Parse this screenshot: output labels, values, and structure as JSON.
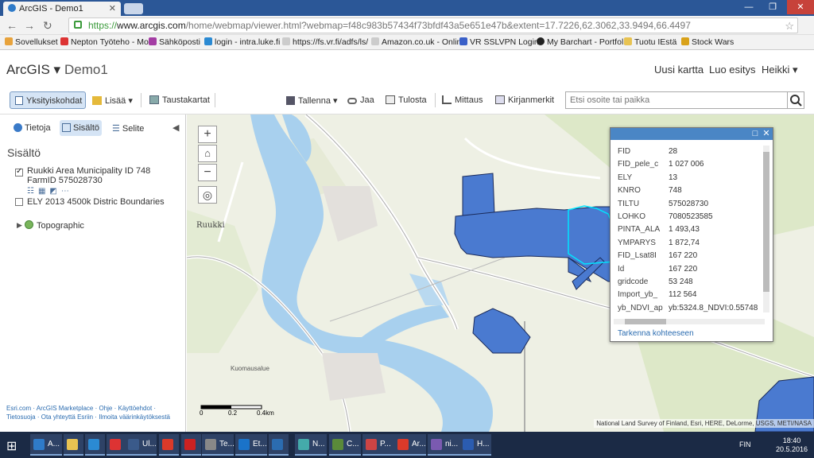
{
  "browser": {
    "tab_title": "ArcGIS - Demo1",
    "url_scheme": "https://",
    "url_host": "www.arcgis.com",
    "url_rest": "/home/webmap/viewer.html?webmap=f48c983b57434f73bfdf43a5e651e47b&extent=17.7226,62.3062,33.9494,66.4497",
    "bookmarks": [
      "Sovellukset",
      "Nepton Työteho - Mo",
      "Sähköposti",
      "login - intra.luke.fi",
      "https://fs.vr.fi/adfs/ls/",
      "Amazon.co.uk - Onlin",
      "VR SSLVPN Login",
      "My Barchart - Portfolio",
      "Tuotu IEstä",
      "Stock Wars"
    ]
  },
  "header": {
    "brand": "ArcGIS ▾",
    "map_title": "Demo1",
    "new_map": "Uusi kartta",
    "create_presentation": "Luo esitys",
    "user": "Heikki ▾"
  },
  "toolbar": {
    "details": "Yksityiskohdat",
    "add": "Lisää",
    "basemaps": "Taustakartat",
    "save": "Tallenna",
    "share": "Jaa",
    "print": "Tulosta",
    "measure": "Mittaus",
    "bookmarks": "Kirjanmerkit",
    "search_placeholder": "Etsi osoite tai paikka"
  },
  "panel": {
    "tabs": [
      "Tietoja",
      "Sisältö",
      "Selite"
    ],
    "heading": "Sisältö",
    "layers": [
      {
        "name": "Ruukki Area Municipality ID 748",
        "sub": "FarmID 575028730",
        "checked": true
      },
      {
        "name": "ELY 2013 4500k Distric Boundaries",
        "checked": false
      },
      {
        "name": "Topographic",
        "checked": null
      }
    ],
    "footer": "Esri.com · ArcGIS Marketplace · Ohje · Käyttöehdot · Tietosuoja · Ota yhteyttä Esriin · Ilmoita väärinkäytöksestä"
  },
  "map": {
    "labels": {
      "ruukki": "Ruukki",
      "kuomausalue": "Kuomausalue",
      "scale": [
        "0",
        "0.2",
        "0.4km"
      ]
    },
    "attribution": "National Land Survey of Finland, Esri, HERE, DeLorme, USGS, METI/NASA",
    "polygon_fill": "#4a7ad0",
    "highlight": "#00e5ff"
  },
  "popup": {
    "rows": [
      {
        "k": "FID",
        "v": "28"
      },
      {
        "k": "FID_pele_c",
        "v": "1 027 006"
      },
      {
        "k": "ELY",
        "v": "13"
      },
      {
        "k": "KNRO",
        "v": "748"
      },
      {
        "k": "TILTU",
        "v": "575028730"
      },
      {
        "k": "LOHKO",
        "v": "7080523585"
      },
      {
        "k": "PINTA_ALA",
        "v": "1 493,43"
      },
      {
        "k": "YMPARYS",
        "v": "1 872,74"
      },
      {
        "k": "FID_Lsat8I",
        "v": "167 220"
      },
      {
        "k": "Id",
        "v": "167 220"
      },
      {
        "k": "gridcode",
        "v": "53 248"
      },
      {
        "k": "Import_yb_",
        "v": "112 564"
      },
      {
        "k": "yb_NDVI_ap",
        "v": "yb:5324.8_NDVI:0.55748"
      }
    ],
    "zoom_to": "Tarkenna kohteeseen"
  },
  "taskbar": {
    "items": [
      "A...",
      "",
      "",
      "",
      "Ul...",
      "",
      "",
      "Te...",
      "Et...",
      "",
      "N...",
      "C...",
      "P...",
      "Ar...",
      "ni...",
      "H..."
    ],
    "lang": "FIN",
    "time": "18:40",
    "date": "20.5.2016"
  }
}
